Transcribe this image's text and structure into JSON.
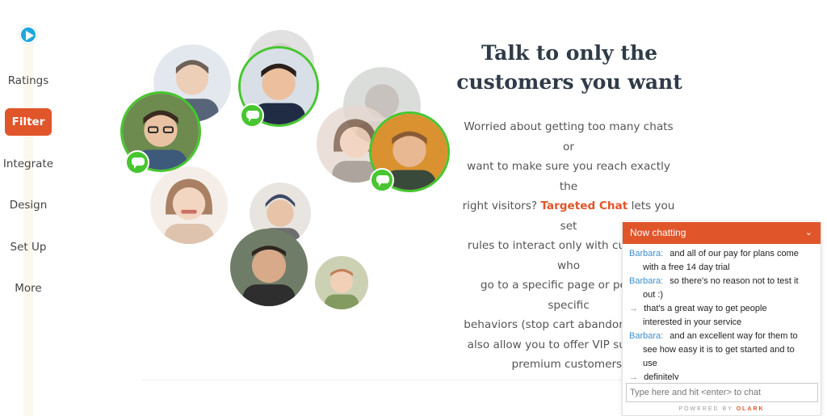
{
  "nav": {
    "items": [
      {
        "label": "Ratings"
      },
      {
        "label": "Filter",
        "active": true
      },
      {
        "label": "Integrate"
      },
      {
        "label": "Design"
      },
      {
        "label": "Set Up"
      },
      {
        "label": "More"
      }
    ]
  },
  "hero": {
    "title_line1": "Talk to only the",
    "title_line2": "customers you want",
    "body_line1": "Worried about getting too many chats or",
    "body_line2": "want to make sure you reach exactly the",
    "body_line3_prefix": "right visitors?",
    "body_link": "Targeted Chat",
    "body_line3_suffix": "lets you set",
    "body_line4": "rules to interact only with customers who",
    "body_line5": "go to a specific page or perform specific",
    "body_line6": "behaviors (stop cart abandonment). It",
    "body_line7": "also allow you to offer VIP support to",
    "body_line8": "premium customers."
  },
  "chat": {
    "header": "Now chatting",
    "messages": [
      {
        "who": "Barbara:",
        "line1": "and all of our pay for plans come",
        "line2": "with a free 14 day trial"
      },
      {
        "who": "Barbara:",
        "line1": "so there's no reason not to test it",
        "line2": "out :)"
      },
      {
        "who": "→",
        "line1": "that's a great way to get people",
        "line2": "interested in your service"
      },
      {
        "who": "Barbara:",
        "line1": "and an excellent way for them to",
        "line2": "see how easy it is to get started and to",
        "line3": "use"
      },
      {
        "who": "→",
        "line1": "definitely"
      }
    ],
    "input_placeholder": "Type here and hit <enter> to chat",
    "powered_prefix": "POWERED BY",
    "powered_brand": "OLARK"
  },
  "colors": {
    "accent": "#e0552a",
    "chat_green": "#47c62f",
    "play_blue": "#1ea7dd",
    "agent_name": "#3d8fd1"
  }
}
